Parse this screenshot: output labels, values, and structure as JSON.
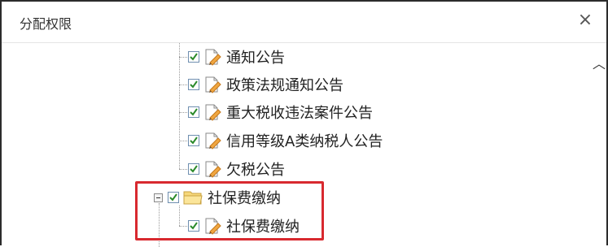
{
  "dialog": {
    "title": "分配权限",
    "close_glyph": "×"
  },
  "tree": {
    "items": [
      {
        "label": "通知公告",
        "checked": true,
        "type": "file"
      },
      {
        "label": "政策法规通知公告",
        "checked": true,
        "type": "file"
      },
      {
        "label": "重大税收违法案件公告",
        "checked": true,
        "type": "file"
      },
      {
        "label": "信用等级A类纳税人公告",
        "checked": true,
        "type": "file"
      },
      {
        "label": "欠税公告",
        "checked": true,
        "type": "file"
      }
    ],
    "folder": {
      "label": "社保费缴纳",
      "checked": true,
      "expanded": true,
      "type": "folder"
    },
    "child": {
      "label": "社保费缴纳",
      "checked": true,
      "type": "file"
    }
  },
  "colors": {
    "highlight": "#d8292f",
    "check": "#2a8a2a"
  }
}
